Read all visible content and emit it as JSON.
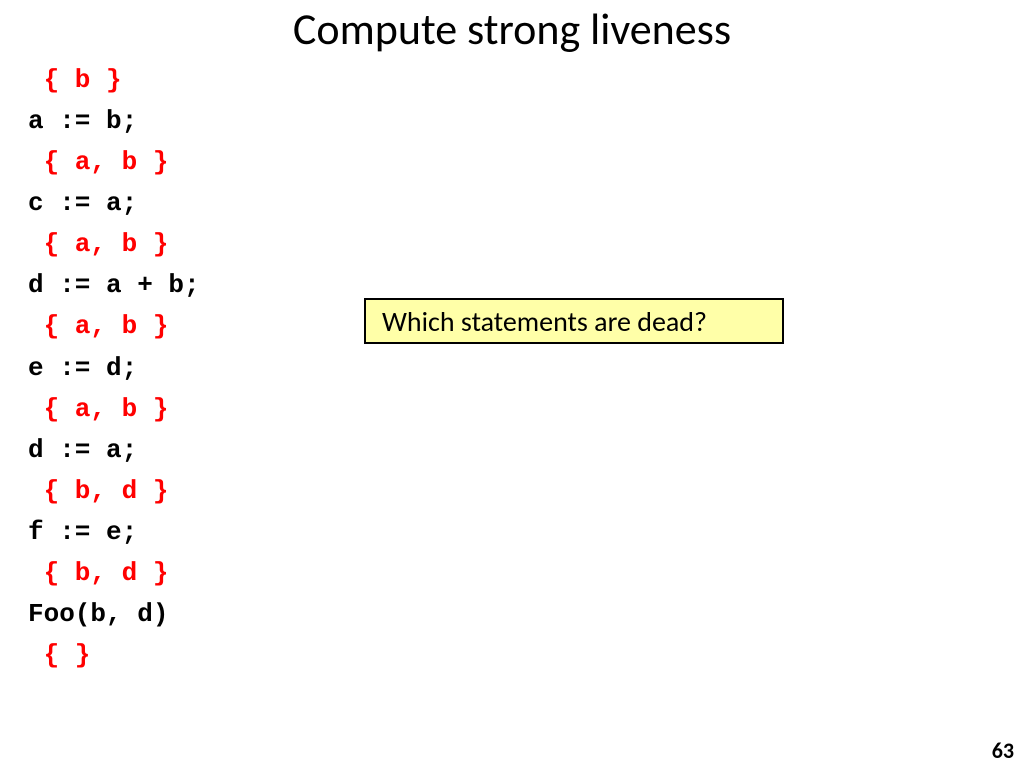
{
  "title": "Compute strong liveness",
  "code": {
    "lines": [
      {
        "kind": "ann",
        "text": " { b }"
      },
      {
        "kind": "stmt",
        "text": "a := b;"
      },
      {
        "kind": "ann",
        "text": " { a, b }"
      },
      {
        "kind": "stmt",
        "text": "c := a;"
      },
      {
        "kind": "ann",
        "text": " { a, b }"
      },
      {
        "kind": "stmt",
        "text": "d := a + b;"
      },
      {
        "kind": "ann",
        "text": " { a, b }"
      },
      {
        "kind": "stmt",
        "text": "e := d;"
      },
      {
        "kind": "ann",
        "text": " { a, b }"
      },
      {
        "kind": "stmt",
        "text": "d := a;"
      },
      {
        "kind": "ann",
        "text": " { b, d }"
      },
      {
        "kind": "stmt",
        "text": "f := e;"
      },
      {
        "kind": "ann",
        "text": " { b, d }"
      },
      {
        "kind": "stmt",
        "text": "Foo(b, d)"
      },
      {
        "kind": "ann",
        "text": " { }"
      }
    ]
  },
  "callout": "Which statements are dead?",
  "page_number": "63"
}
